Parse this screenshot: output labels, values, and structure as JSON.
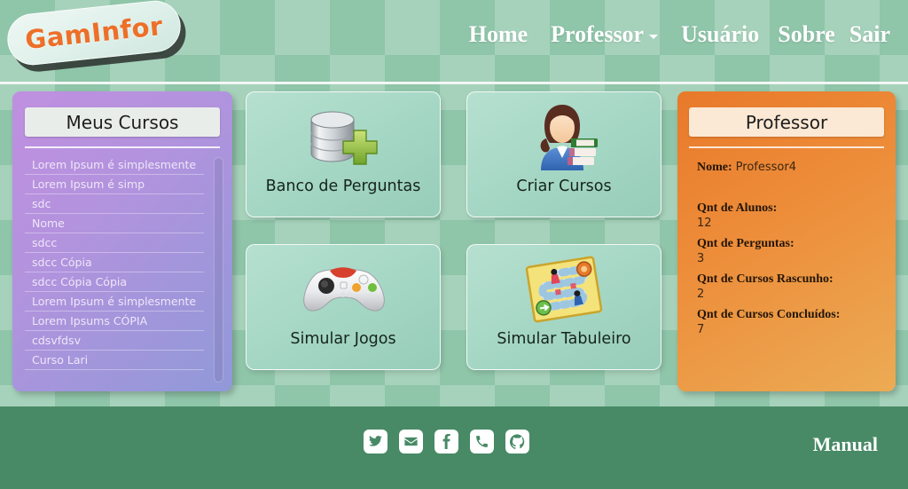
{
  "header": {
    "logo_text": "GamInfor",
    "nav": [
      {
        "label": "Home",
        "icon": null
      },
      {
        "label": "Professor",
        "icon": "chevron-down-icon"
      },
      {
        "label": "Usuário",
        "icon": null
      },
      {
        "label": "Sobre",
        "icon": null
      },
      {
        "label": "Sair",
        "icon": null
      }
    ]
  },
  "courses_panel": {
    "title": "Meus Cursos",
    "items": [
      "Lorem Ipsum é simplesmente",
      "Lorem Ipsum é simp",
      "sdc",
      "Nome",
      "sdcc",
      "sdcc Cópia",
      "sdcc Cópia Cópia",
      "Lorem Ipsum é simplesmente",
      "Lorem Ipsums CÓPIA",
      "cdsvfdsv",
      "Curso Lari"
    ]
  },
  "cards": [
    {
      "label": "Banco de Perguntas",
      "icon": "database-add-icon"
    },
    {
      "label": "Criar Cursos",
      "icon": "teacher-books-icon"
    },
    {
      "label": "Simular Jogos",
      "icon": "gamepad-icon"
    },
    {
      "label": "Simular Tabuleiro",
      "icon": "board-game-icon"
    }
  ],
  "professor_panel": {
    "title": "Professor",
    "name_label": "Nome:",
    "name_value": "Professor4",
    "stats": [
      {
        "label": "Qnt de Alunos:",
        "value": "12"
      },
      {
        "label": "Qnt de Perguntas:",
        "value": "3"
      },
      {
        "label": "Qnt de Cursos Rascunho:",
        "value": "2"
      },
      {
        "label": "Qnt de Cursos Concluídos:",
        "value": "7"
      }
    ]
  },
  "footer": {
    "social": [
      {
        "name": "twitter-icon"
      },
      {
        "name": "email-icon"
      },
      {
        "name": "facebook-icon"
      },
      {
        "name": "phone-icon"
      },
      {
        "name": "github-icon"
      }
    ],
    "manual_label": "Manual"
  },
  "colors": {
    "brand_orange": "#ed6f28",
    "header_green": "#8fc5a9",
    "footer_green": "#488a66",
    "card_mint": "#a8d8c5",
    "panel_purple": "#b293de",
    "panel_orange": "#ed8e3b"
  }
}
